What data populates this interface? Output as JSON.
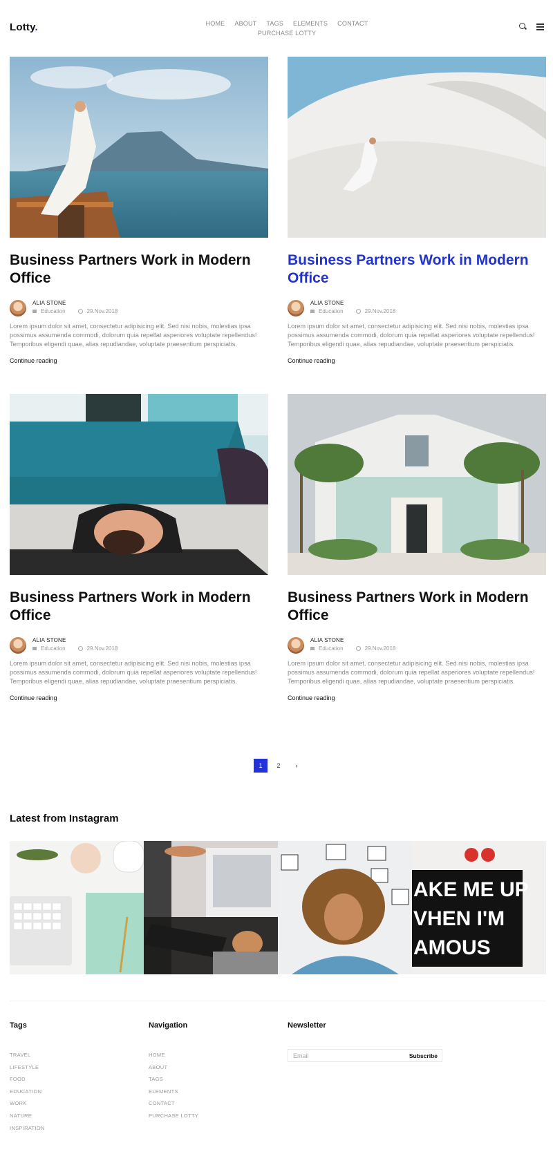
{
  "brand": {
    "name": "Lotty",
    "dot": ".",
    "accent": "#2233dd"
  },
  "nav": {
    "items": [
      "HOME",
      "ABOUT",
      "TAGS",
      "ELEMENTS",
      "CONTACT",
      "PURCHASE LOTTY"
    ]
  },
  "header_icons": [
    "search-icon",
    "menu-icon"
  ],
  "posts": [
    {
      "title": "Business Partners Work in Modern Office",
      "author": "ALIA STONE",
      "category": "Education",
      "date": "29.Nov.2018",
      "excerpt": "Lorem ipsum dolor sit amet, consectetur adipisicing elit. Sed nisi nobis, molestias ipsa possimus assumenda commodi, dolorum quia repellat asperiores voluptate repellendus! Temporibus eligendi quae, alias repudiandae, voluptate praesentium perspiciatis.",
      "read_more": "Continue reading"
    },
    {
      "title": "Business Partners Work in Modern Office",
      "author": "ALIA STONE",
      "category": "Education",
      "date": "29.Nov.2018",
      "excerpt": "Lorem ipsum dolor sit amet, consectetur adipisicing elit. Sed nisi nobis, molestias ipsa possimus assumenda commodi, dolorum quia repellat asperiores voluptate repellendus! Temporibus eligendi quae, alias repudiandae, voluptate praesentium perspiciatis.",
      "read_more": "Continue reading"
    },
    {
      "title": "Business Partners Work in Modern Office",
      "author": "ALIA STONE",
      "category": "Education",
      "date": "29.Nov.2018",
      "excerpt": "Lorem ipsum dolor sit amet, consectetur adipisicing elit. Sed nisi nobis, molestias ipsa possimus assumenda commodi, dolorum quia repellat asperiores voluptate repellendus! Temporibus eligendi quae, alias repudiandae, voluptate praesentium perspiciatis.",
      "read_more": "Continue reading"
    },
    {
      "title": "Business Partners Work in Modern Office",
      "author": "ALIA STONE",
      "category": "Education",
      "date": "29.Nov.2018",
      "excerpt": "Lorem ipsum dolor sit amet, consectetur adipisicing elit. Sed nisi nobis, molestias ipsa possimus assumenda commodi, dolorum quia repellat asperiores voluptate repellendus! Temporibus eligendi quae, alias repudiandae, voluptate praesentium perspiciatis.",
      "read_more": "Continue reading"
    }
  ],
  "pagination": {
    "pages": [
      "1",
      "2"
    ],
    "current": "1",
    "next": "›"
  },
  "instagram": {
    "title": "Latest from Instagram",
    "sign_text": "AKE ME UP\nVHEN I'M\nAMOUS"
  },
  "footer": {
    "tags": {
      "title": "Tags",
      "items": [
        "TRAVEL",
        "LIFESTYLE",
        "FOOD",
        "EDUCATION",
        "WORK",
        "NATURE",
        "INSPIRATION"
      ]
    },
    "navigation": {
      "title": "Navigation",
      "items": [
        "HOME",
        "ABOUT",
        "TAGS",
        "ELEMENTS",
        "CONTACT",
        "PURCHASE LOTTY"
      ]
    },
    "newsletter": {
      "title": "Newsletter",
      "placeholder": "Email",
      "button": "Subscribe"
    }
  }
}
